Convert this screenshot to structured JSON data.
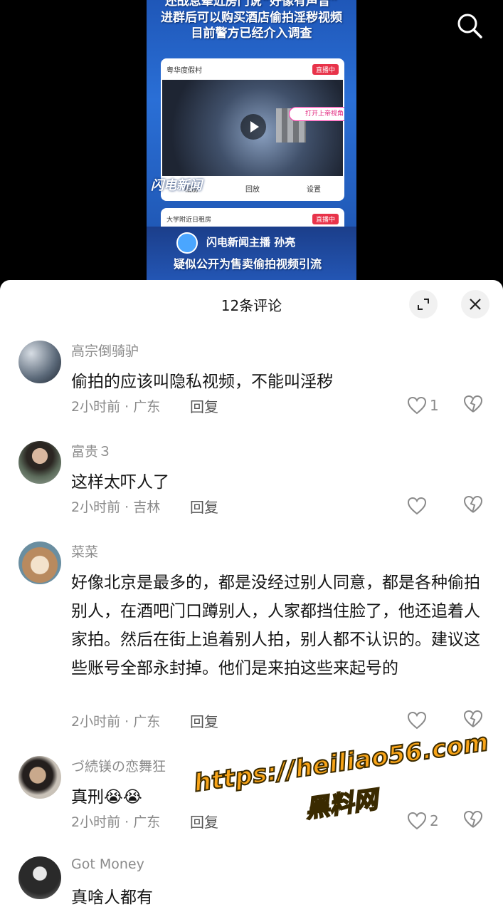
{
  "video": {
    "headline_lines": [
      "还战息辈近房门说“好像有声音”",
      "进群后可以购买酒店偷拍淫秽视频",
      "目前警方已经介入调查"
    ],
    "phone1": {
      "place": "粤华度假村",
      "live_badge": "直播中",
      "open_view": "打开上帝视角",
      "controls": [
        "相册",
        "回放",
        "设置"
      ]
    },
    "phone2": {
      "place": "大学附近日租房",
      "live_badge": "直播中"
    },
    "channel_logo": "闪电新闻",
    "anchor": "闪电新闻主播 孙亮",
    "subtitle": "疑似公开为售卖偷拍视频引流"
  },
  "comments_sheet": {
    "title": "12条评论",
    "comments": [
      {
        "user": "高宗倒骑驴",
        "text": "偷拍的应该叫隐私视频，不能叫淫秽",
        "meta": "2小时前 · 广东",
        "reply": "回复",
        "likes": "1"
      },
      {
        "user": "富贵３",
        "text": "这样太吓人了",
        "meta": "2小时前 · 吉林",
        "reply": "回复",
        "likes": ""
      },
      {
        "user": "菜菜",
        "text": "好像北京是最多的，都是没经过别人同意，都是各种偷拍别人，在酒吧门口蹲别人，人家都挡住脸了，他还追着人家拍。然后在街上追着别人拍，别人都不认识的。建议这些账号全部永封掉。他们是来拍这些来起号的",
        "meta": "2小时前 · 广东",
        "reply": "回复",
        "likes": ""
      },
      {
        "user": "づ続镁の恋舞狂",
        "text": "真刑😭😭",
        "meta": "2小时前 · 广东",
        "reply": "回复",
        "likes": "2"
      },
      {
        "user": "Got Money",
        "text": "真啥人都有",
        "meta": "",
        "reply": "",
        "likes": ""
      }
    ]
  },
  "watermark": {
    "line1": "https://heiliao56.com",
    "line2": "黑料网"
  },
  "colors": {
    "sheet_bg": "#ffffff",
    "text": "#161616",
    "muted": "#8a8a8a",
    "video_blue": "#2a6fd6",
    "watermark": "#f8a418"
  }
}
